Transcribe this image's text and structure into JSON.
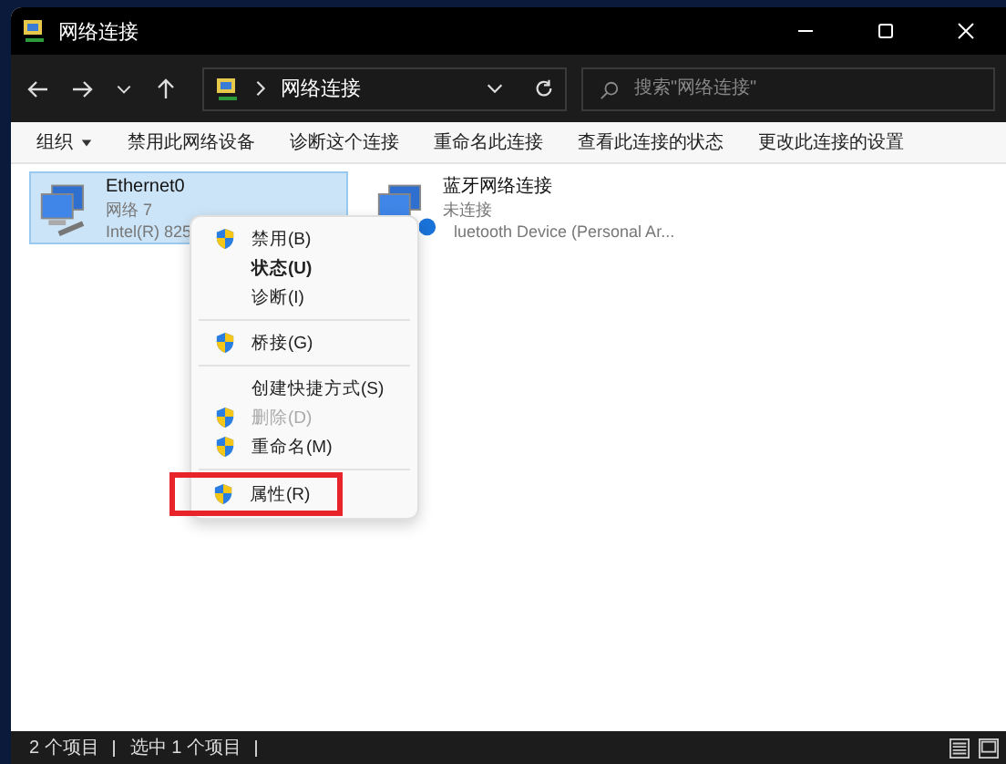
{
  "window": {
    "title": "网络连接"
  },
  "address": {
    "path": "网络连接"
  },
  "search": {
    "placeholder": "搜索\"网络连接\""
  },
  "toolbar": [
    {
      "label": "组织",
      "dropdown": true
    },
    {
      "label": "禁用此网络设备",
      "dropdown": false
    },
    {
      "label": "诊断这个连接",
      "dropdown": false
    },
    {
      "label": "重命名此连接",
      "dropdown": false
    },
    {
      "label": "查看此连接的状态",
      "dropdown": false
    },
    {
      "label": "更改此连接的设置",
      "dropdown": false
    }
  ],
  "connections": [
    {
      "name": "Ethernet0",
      "status": "网络 7",
      "device": "Intel(R) 825",
      "kind": "ethernet",
      "selected": true
    },
    {
      "name": "蓝牙网络连接",
      "status": "未连接",
      "device": "luetooth Device (Personal Ar...",
      "kind": "bluetooth",
      "selected": false
    }
  ],
  "context_menu": [
    {
      "kind": "item",
      "label": "禁用(B)",
      "shield": true,
      "default": false,
      "disabled": false,
      "highlighted": false
    },
    {
      "kind": "item",
      "label": "状态(U)",
      "shield": false,
      "default": true,
      "disabled": false,
      "highlighted": false
    },
    {
      "kind": "item",
      "label": "诊断(I)",
      "shield": false,
      "default": false,
      "disabled": false,
      "highlighted": false
    },
    {
      "kind": "separator"
    },
    {
      "kind": "item",
      "label": "桥接(G)",
      "shield": true,
      "default": false,
      "disabled": false,
      "highlighted": false
    },
    {
      "kind": "separator"
    },
    {
      "kind": "item",
      "label": "创建快捷方式(S)",
      "shield": false,
      "default": false,
      "disabled": false,
      "highlighted": false
    },
    {
      "kind": "item",
      "label": "删除(D)",
      "shield": true,
      "default": false,
      "disabled": true,
      "highlighted": false
    },
    {
      "kind": "item",
      "label": "重命名(M)",
      "shield": true,
      "default": false,
      "disabled": false,
      "highlighted": false
    },
    {
      "kind": "separator"
    },
    {
      "kind": "item",
      "label": "属性(R)",
      "shield": true,
      "default": false,
      "disabled": false,
      "highlighted": true
    }
  ],
  "status_bar": {
    "count": "2 个项目",
    "selection": "选中 1 个项目"
  }
}
